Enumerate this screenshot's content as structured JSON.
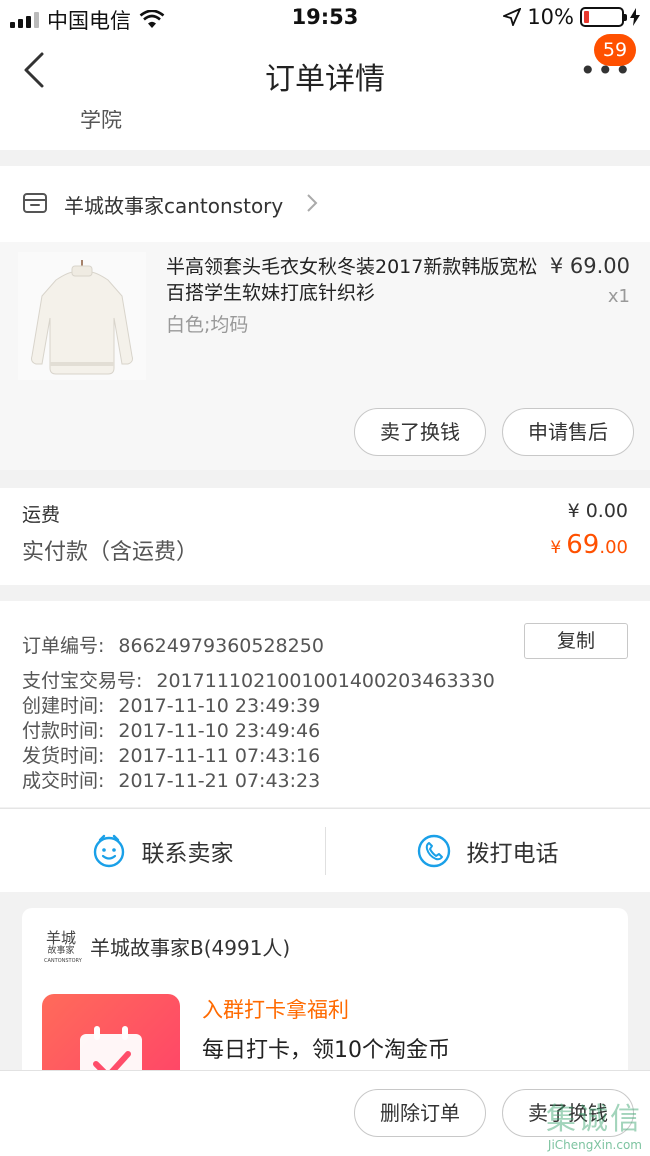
{
  "status_bar": {
    "carrier": "中国电信",
    "time": "19:53",
    "battery": "10%"
  },
  "nav": {
    "title": "订单详情",
    "badge_count": "59"
  },
  "address_tail": "学院",
  "shop": {
    "name": "羊城故事家cantonstory"
  },
  "item": {
    "title": "半高领套头毛衣女秋冬装2017新款韩版宽松百搭学生软妹打底针织衫",
    "price": "¥ 69.00",
    "qty": "x1",
    "sku": "白色;均码",
    "btn_sell": "卖了换钱",
    "btn_aftersale": "申请售后"
  },
  "fees": {
    "shipping_label": "运费",
    "shipping_value": "¥ 0.00",
    "paid_label": "实付款（含运费）",
    "paid_currency": "¥",
    "paid_int": "69",
    "paid_dec": ".00"
  },
  "order_info": {
    "copy_label": "复制",
    "rows": [
      {
        "label": "订单编号:",
        "value": "86624979360528250"
      },
      {
        "label": "支付宝交易号:",
        "value": "2017111021001001400203463330"
      },
      {
        "label": "创建时间:",
        "value": "2017-11-10 23:49:39"
      },
      {
        "label": "付款时间:",
        "value": "2017-11-10 23:49:46"
      },
      {
        "label": "发货时间:",
        "value": "2017-11-11 07:43:16"
      },
      {
        "label": "成交时间:",
        "value": "2017-11-21 07:43:23"
      }
    ]
  },
  "contact": {
    "seller": "联系卖家",
    "phone": "拨打电话"
  },
  "group": {
    "logo_text": "羊城故事家",
    "logo_sub": "CANTONSTORY",
    "name": "羊城故事家B(4991人)",
    "headline": "入群打卡拿福利",
    "subline": "每日打卡，领10个淘金币"
  },
  "bottom_bar": {
    "delete_label": "删除订单",
    "sell_label": "卖了换钱"
  },
  "watermark": {
    "cn": "集诚信",
    "en": "JiChengXin.com"
  },
  "colors": {
    "accent": "#ff5000",
    "orange_text": "#ff6a00",
    "contact_blue": "#1aa0e8"
  }
}
